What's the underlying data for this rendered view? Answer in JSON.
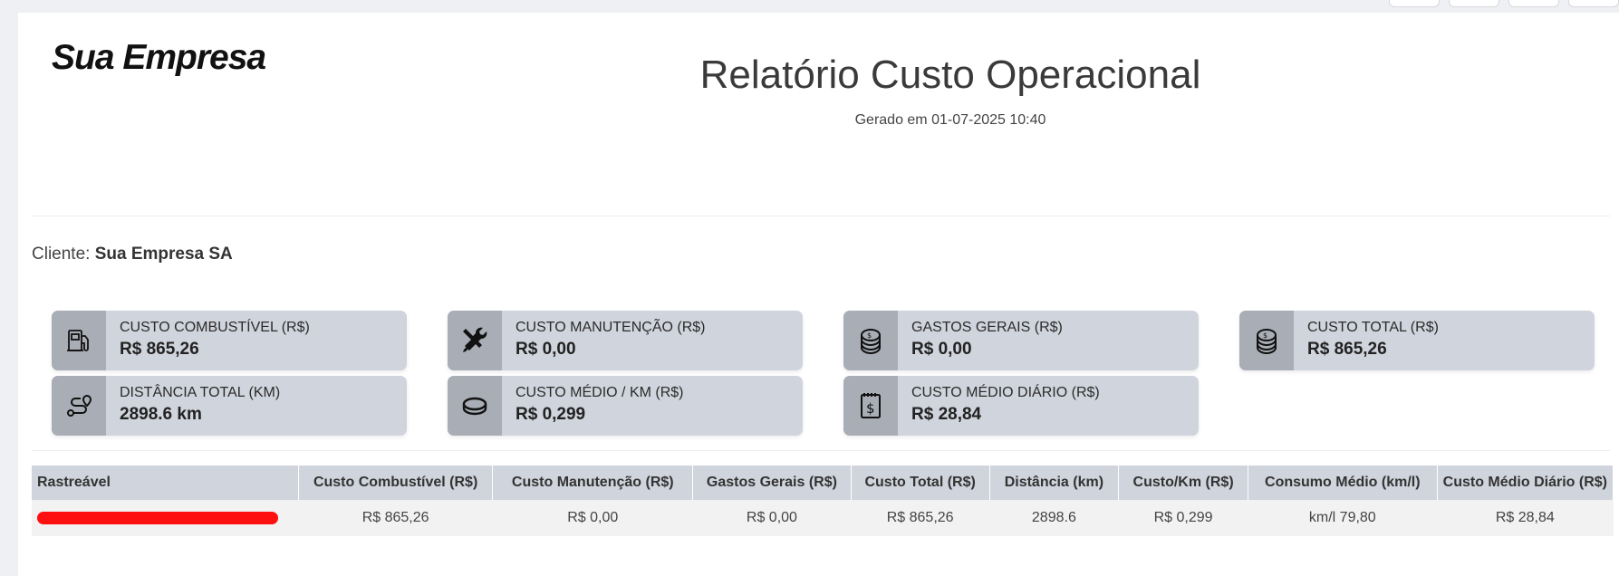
{
  "header": {
    "company_logo": "Sua Empresa",
    "title": "Relatório Custo Operacional",
    "generated": "Gerado em 01-07-2025 10:40"
  },
  "client": {
    "label": "Cliente:",
    "name": "Sua Empresa SA"
  },
  "cards": {
    "fuel": {
      "label": "CUSTO COMBUSTÍVEL (R$)",
      "value": "R$ 865,26",
      "icon": "fuel-pump-icon"
    },
    "maintenance": {
      "label": "CUSTO MANUTENÇÃO (R$)",
      "value": "R$ 0,00",
      "icon": "tools-icon"
    },
    "general": {
      "label": "GASTOS GERAIS (R$)",
      "value": "R$ 0,00",
      "icon": "coins-stack-icon"
    },
    "total": {
      "label": "CUSTO TOTAL (R$)",
      "value": "R$ 865,26",
      "icon": "coins-stack-icon"
    },
    "distance": {
      "label": "DISTÂNCIA TOTAL (KM)",
      "value": "2898.6 km",
      "icon": "route-icon"
    },
    "avg_km": {
      "label": "CUSTO MÉDIO / KM (R$)",
      "value": "R$ 0,299",
      "icon": "coin-icon"
    },
    "avg_daily": {
      "label": "CUSTO MÉDIO DIÁRIO (R$)",
      "value": "R$ 28,84",
      "icon": "receipt-icon"
    }
  },
  "table": {
    "headers": [
      "Rastreável",
      "Custo Combustível (R$)",
      "Custo Manutenção (R$)",
      "Gastos Gerais (R$)",
      "Custo Total (R$)",
      "Distância (km)",
      "Custo/Km (R$)",
      "Consumo Médio (km/l)",
      "Custo Médio Diário (R$)"
    ],
    "rows": [
      [
        "",
        "R$ 865,26",
        "R$ 0,00",
        "R$ 0,00",
        "R$ 865,26",
        "2898.6",
        "R$ 0,299",
        "km/l 79,80",
        "R$ 28,84"
      ]
    ]
  },
  "colors": {
    "card_bg": "#d0d4dc",
    "icon_bg": "#a9adb5",
    "redaction": "#ff1010"
  }
}
